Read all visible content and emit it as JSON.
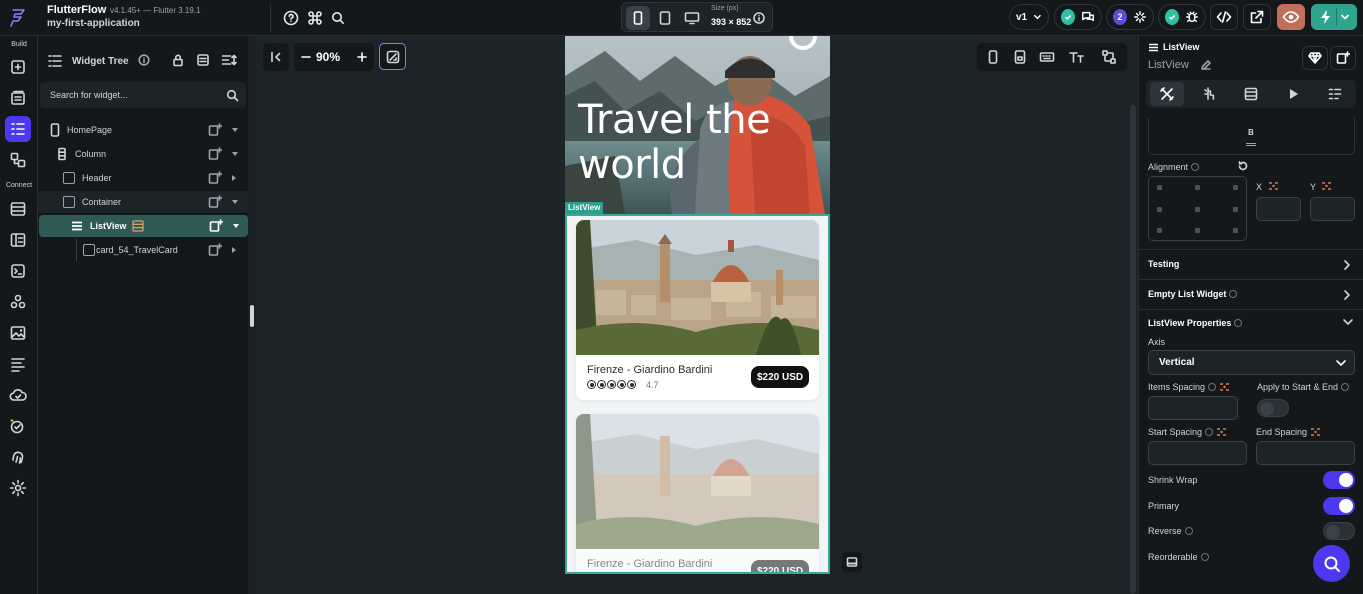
{
  "topbar": {
    "app_name": "FlutterFlow",
    "app_version": "v4.1.45+ — Flutter 3.19.1",
    "project_name": "my-first-application",
    "size_label": "Size (px)",
    "size_value": "393 × 852",
    "version_label": "v1",
    "collab_count": "2"
  },
  "rail": {
    "build_label": "Build",
    "connect_label": "Connect"
  },
  "tree": {
    "title": "Widget Tree",
    "search_placeholder": "Search for widget...",
    "nodes": [
      {
        "label": "HomePage"
      },
      {
        "label": "Column"
      },
      {
        "label": "Header"
      },
      {
        "label": "Container"
      },
      {
        "label": "ListView"
      },
      {
        "label": "card_54_TravelCard"
      }
    ]
  },
  "canvas": {
    "zoom": "90%",
    "hero_title": "Travel the world",
    "listview_tag": "ListView",
    "cards": [
      {
        "name": "Firenze - Giardino Bardini",
        "rating": "4.7",
        "rating_stars": 5,
        "price": "$220 USD"
      },
      {
        "name": "Firenze - Giardino Bardini",
        "price": "$220 USD"
      }
    ]
  },
  "props": {
    "widget_name": "ListView",
    "widget_subtitle": "ListView",
    "padding_bottom_label": "B",
    "alignment_label": "Alignment",
    "x_label": "X",
    "y_label": "Y",
    "sections": {
      "testing": "Testing",
      "empty_list": "Empty List Widget",
      "listview_props": "ListView Properties"
    },
    "axis_label": "Axis",
    "axis_value": "Vertical",
    "items_spacing_label": "Items Spacing",
    "apply_label": "Apply to Start & End",
    "start_spacing_label": "Start Spacing",
    "end_spacing_label": "End Spacing",
    "shrink_wrap_label": "Shrink Wrap",
    "primary_label": "Primary",
    "reverse_label": "Reverse",
    "reorderable_label": "Reorderable",
    "toggles": {
      "apply": false,
      "shrink_wrap": true,
      "primary": true,
      "reverse": false
    }
  },
  "colors": {
    "accent": "#4b39ef",
    "selection": "#2f5a56",
    "teal": "#2fbfa1",
    "background": "#1d2428",
    "panel": "#14181b"
  }
}
